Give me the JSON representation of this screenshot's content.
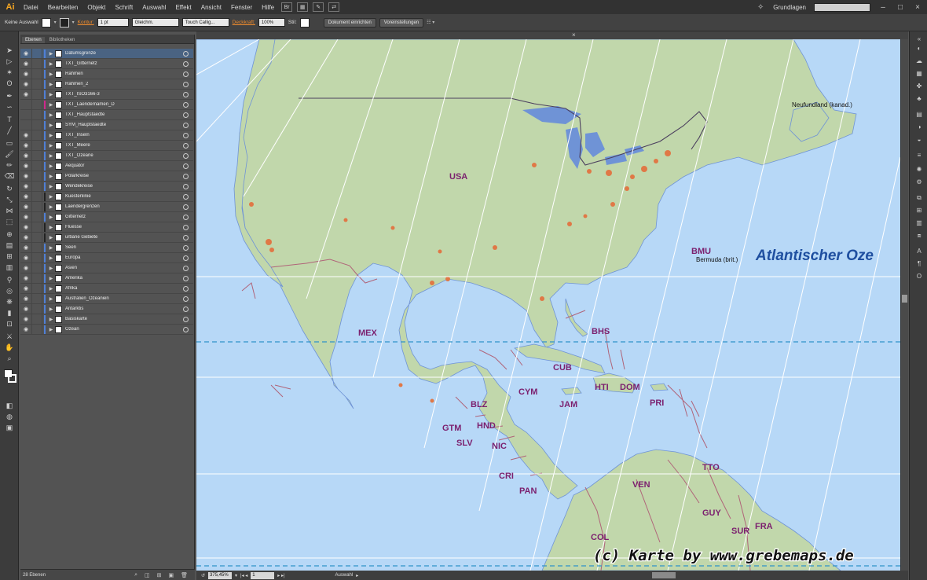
{
  "app": {
    "logo": "Ai",
    "workspace": "Grundlagen"
  },
  "menu": [
    "Datei",
    "Bearbeiten",
    "Objekt",
    "Schrift",
    "Auswahl",
    "Effekt",
    "Ansicht",
    "Fenster",
    "Hilfe"
  ],
  "control_bar": {
    "selection": "Keine Auswahl",
    "stroke_label": "Kontur:",
    "stroke_weight": "1 pt",
    "stroke_profile": "Gleichm.",
    "brush": "Touch Callig...",
    "opacity_label": "Deckkraft:",
    "opacity": "100%",
    "style_label": "Stil:",
    "doc_setup": "Dokument einrichten",
    "preferences": "Voreinstellungen"
  },
  "panel": {
    "tabs": [
      "Ebenen",
      "Bibliotheken"
    ],
    "layer_count": "28 Ebenen",
    "layers": [
      {
        "name": "Datumsgrenze",
        "color": "#4f7fd6",
        "visible": true,
        "selected": true
      },
      {
        "name": "TXT_Gitternetz",
        "color": "#4f7fd6",
        "visible": true
      },
      {
        "name": "Rahmen",
        "color": "#4f7fd6",
        "visible": true
      },
      {
        "name": "Rahmen_2",
        "color": "#4f7fd6",
        "visible": true
      },
      {
        "name": "TXT_ISO3166-3",
        "color": "#4f7fd6",
        "visible": true
      },
      {
        "name": "TXT_Laendernamen_D",
        "color": "#d0288d",
        "visible": false
      },
      {
        "name": "TXT_Hauptstaedte",
        "color": "#4f7fd6",
        "visible": false
      },
      {
        "name": "SYM_Hauptstaedte",
        "color": "#4f7fd6",
        "visible": false
      },
      {
        "name": "TXT_Inseln",
        "color": "#4f7fd6",
        "visible": true
      },
      {
        "name": "TXT_Meere",
        "color": "#4f7fd6",
        "visible": true
      },
      {
        "name": "TXT_Ozeane",
        "color": "#4f7fd6",
        "visible": true
      },
      {
        "name": "Aequator",
        "color": "#4f7fd6",
        "visible": true
      },
      {
        "name": "Polarkreise",
        "color": "#4f7fd6",
        "visible": true
      },
      {
        "name": "Wendekreise",
        "color": "#4f7fd6",
        "visible": true
      },
      {
        "name": "Kuestenlinie",
        "color": "#222222",
        "visible": true
      },
      {
        "name": "Laendergrenzen",
        "color": "#222222",
        "visible": true
      },
      {
        "name": "Gitternetz",
        "color": "#4f7fd6",
        "visible": true
      },
      {
        "name": "Fluesse",
        "color": "#222222",
        "visible": true
      },
      {
        "name": "urbane Gebiete",
        "color": "#222222",
        "visible": true
      },
      {
        "name": "Seen",
        "color": "#4f7fd6",
        "visible": true
      },
      {
        "name": "Europa",
        "color": "#4f7fd6",
        "visible": true
      },
      {
        "name": "Asien",
        "color": "#4f7fd6",
        "visible": true
      },
      {
        "name": "Amerika",
        "color": "#4f7fd6",
        "visible": true
      },
      {
        "name": "Afrika",
        "color": "#4f7fd6",
        "visible": true
      },
      {
        "name": "Australien_Ozeanien",
        "color": "#4f7fd6",
        "visible": true
      },
      {
        "name": "Antarktis",
        "color": "#4f7fd6",
        "visible": true
      },
      {
        "name": "Basiskarte",
        "color": "#4f7fd6",
        "visible": true
      },
      {
        "name": "Ozean",
        "color": "#4f7fd6",
        "visible": true
      }
    ]
  },
  "status_bar": {
    "zoom": "375,45%",
    "artboard": "1",
    "mode": "Auswahl"
  },
  "map": {
    "countries": [
      "USA",
      "MEX",
      "BHS",
      "CUB",
      "CYM",
      "HTI",
      "DOM",
      "JAM",
      "PRI",
      "BLZ",
      "GTM",
      "HND",
      "SLV",
      "NIC",
      "CRI",
      "PAN",
      "TTO",
      "VEN",
      "GUY",
      "SUR",
      "FRA",
      "COL",
      "BMU"
    ],
    "bermuda": "Bermuda (brit.)",
    "newfoundland": "Neufundland (kanad.)",
    "ocean": "Atlantischer Oze",
    "copyright": "(c) Karte by www.grebemaps.de",
    "colors": {
      "ocean": "#b7d8f7",
      "land": "#c1d7ab",
      "border": "#b06479",
      "urban": "#e07846",
      "river": "#6f93d6"
    }
  }
}
